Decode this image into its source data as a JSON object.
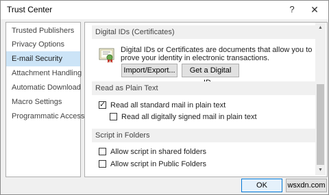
{
  "window": {
    "title": "Trust Center",
    "help_glyph": "?",
    "close_glyph": "✕"
  },
  "sidebar": {
    "items": [
      {
        "label": "Trusted Publishers",
        "selected": false
      },
      {
        "label": "Privacy Options",
        "selected": false
      },
      {
        "label": "E-mail Security",
        "selected": true
      },
      {
        "label": "Attachment Handling",
        "selected": false
      },
      {
        "label": "Automatic Download",
        "selected": false
      },
      {
        "label": "Macro Settings",
        "selected": false
      },
      {
        "label": "Programmatic Access",
        "selected": false
      }
    ]
  },
  "digital_ids": {
    "header": "Digital IDs (Certificates)",
    "description": "Digital IDs or Certificates are documents that allow you to prove your identity in electronic transactions.",
    "import_export_label": "Import/Export...",
    "get_digital_id_label": "Get a Digital ID..."
  },
  "plain_text": {
    "header": "Read as Plain Text",
    "read_standard_label": "Read all standard mail in plain text",
    "read_standard_checked": true,
    "read_signed_label": "Read all digitally signed mail in plain text",
    "read_signed_checked": false
  },
  "script_folders": {
    "header": "Script in Folders",
    "shared_label": "Allow script in shared folders",
    "shared_checked": false,
    "public_label": "Allow script in Public Folders",
    "public_checked": false
  },
  "footer": {
    "ok_label": "OK",
    "cancel_label": "wsxdn.com"
  },
  "colors": {
    "selection": "#cce4f7",
    "ok_border": "#0078d7"
  }
}
